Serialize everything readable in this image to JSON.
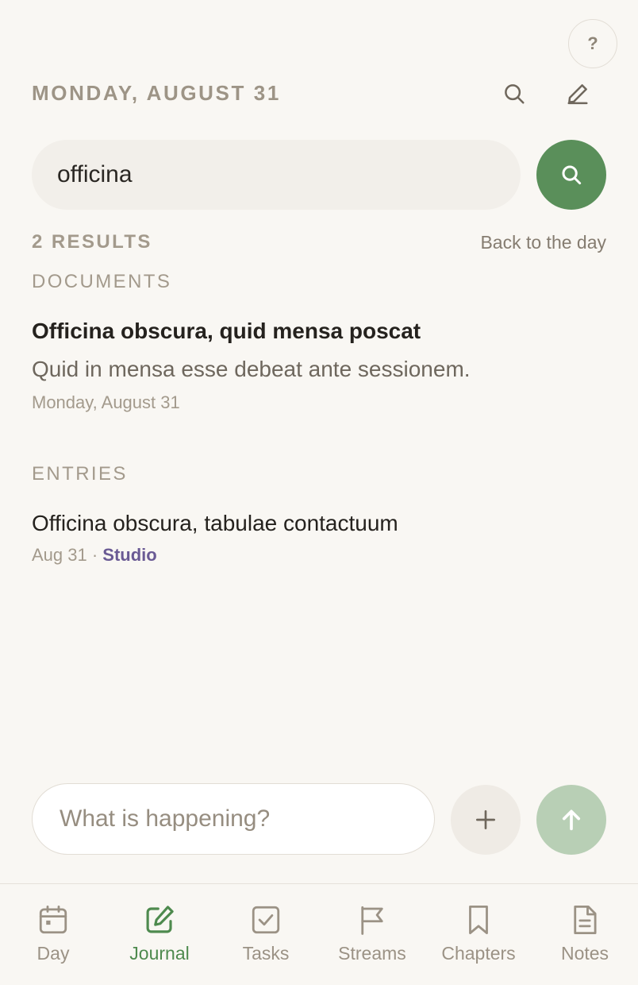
{
  "header": {
    "date": "MONDAY, AUGUST 31",
    "help_label": "?"
  },
  "search": {
    "query": "officina"
  },
  "results": {
    "count_label": "2 RESULTS",
    "back_label": "Back to the day",
    "documents_label": "DOCUMENTS",
    "documents": [
      {
        "title": "Officina obscura, quid mensa poscat",
        "snippet": "Quid in mensa esse debeat ante sessionem.",
        "date": "Monday, August 31"
      }
    ],
    "entries_label": "ENTRIES",
    "entries": [
      {
        "title": "Officina obscura, tabulae contactuum",
        "date": "Aug 31",
        "separator": " · ",
        "stream": "Studio"
      }
    ]
  },
  "composer": {
    "placeholder": "What is happening?"
  },
  "tabs": [
    {
      "label": "Day",
      "icon": "calendar-icon",
      "active": false
    },
    {
      "label": "Journal",
      "icon": "edit-square-icon",
      "active": true
    },
    {
      "label": "Tasks",
      "icon": "checkbox-icon",
      "active": false
    },
    {
      "label": "Streams",
      "icon": "flag-icon",
      "active": false
    },
    {
      "label": "Chapters",
      "icon": "bookmark-icon",
      "active": false
    },
    {
      "label": "Notes",
      "icon": "document-icon",
      "active": false
    }
  ],
  "colors": {
    "background": "#f9f7f3",
    "accent_green": "#5a8f5a",
    "send_disabled": "#b8cfb5",
    "stream_purple": "#6a5a94",
    "muted_text": "#a39a8c"
  }
}
